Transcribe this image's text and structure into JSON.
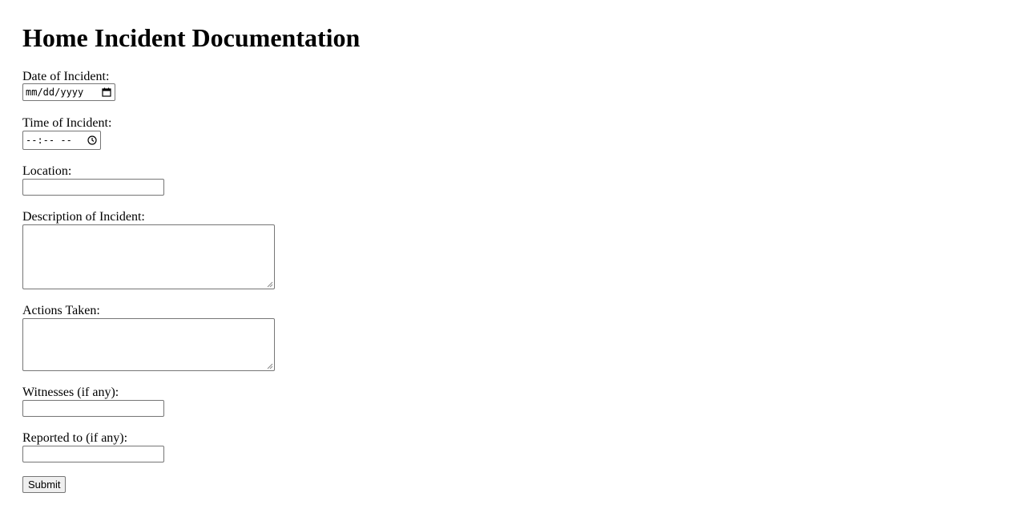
{
  "page": {
    "title": "Home Incident Documentation"
  },
  "form": {
    "date": {
      "label": "Date of Incident:",
      "placeholder": "mm/dd/yyyy",
      "icon": "calendar-icon"
    },
    "time": {
      "label": "Time of Incident:",
      "placeholder": "--:-- --",
      "icon": "clock-icon"
    },
    "location": {
      "label": "Location:",
      "value": ""
    },
    "description": {
      "label": "Description of Incident:",
      "value": ""
    },
    "actions": {
      "label": "Actions Taken:",
      "value": ""
    },
    "witnesses": {
      "label": "Witnesses (if any):",
      "value": ""
    },
    "reported_to": {
      "label": "Reported to (if any):",
      "value": ""
    },
    "submit_label": "Submit"
  }
}
